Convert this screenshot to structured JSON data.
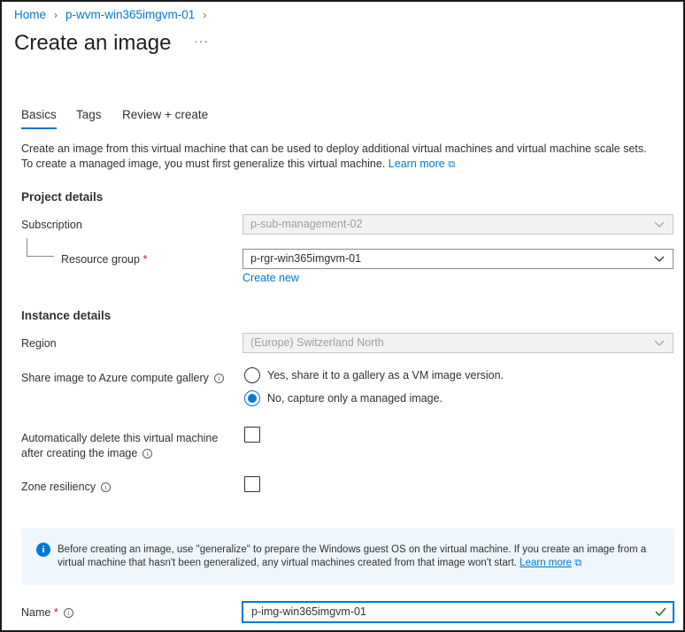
{
  "breadcrumb": {
    "home": "Home",
    "vm": "p-wvm-win365imgvm-01"
  },
  "page": {
    "title": "Create an image",
    "more": "···"
  },
  "tabs": [
    {
      "label": "Basics",
      "active": true
    },
    {
      "label": "Tags",
      "active": false
    },
    {
      "label": "Review + create",
      "active": false
    }
  ],
  "description": {
    "line1": "Create an image from this virtual machine that can be used to deploy additional virtual machines and virtual machine scale sets.",
    "line2": "To create a managed image, you must first generalize this virtual machine.",
    "learn_more": "Learn more"
  },
  "project": {
    "heading": "Project details",
    "subscription_label": "Subscription",
    "subscription_value": "p-sub-management-02",
    "rg_label": "Resource group",
    "rg_required": "*",
    "rg_value": "p-rgr-win365imgvm-01",
    "create_new": "Create new"
  },
  "instance": {
    "heading": "Instance details",
    "region_label": "Region",
    "region_value": "(Europe) Switzerland North",
    "share_label": "Share image to Azure compute gallery",
    "share_yes": "Yes, share it to a gallery as a VM image version.",
    "share_no": "No, capture only a managed image.",
    "share_selected": "no",
    "autodelete_label_1": "Automatically delete this virtual machine",
    "autodelete_label_2": "after creating the image",
    "autodelete_checked": false,
    "zone_label": "Zone resiliency",
    "zone_checked": false
  },
  "banner": {
    "text": "Before creating an image, use \"generalize\" to prepare the Windows guest OS on the virtual machine. If you create an image from a virtual machine that hasn't been generalized, any virtual machines created from that image won't start.",
    "learn_more": "Learn more"
  },
  "name_field": {
    "label": "Name",
    "required": "*",
    "value": "p-img-win365imgvm-01"
  },
  "colors": {
    "accent": "#0078d4",
    "required": "#a4262c",
    "valid": "#107c10",
    "banner_bg": "#eff6fc"
  },
  "icons": {
    "chevron": "chevron-down-icon",
    "breadcrumb_sep": "chevron-right-icon",
    "info": "info-icon",
    "external": "external-link-icon",
    "check": "checkmark-icon"
  }
}
